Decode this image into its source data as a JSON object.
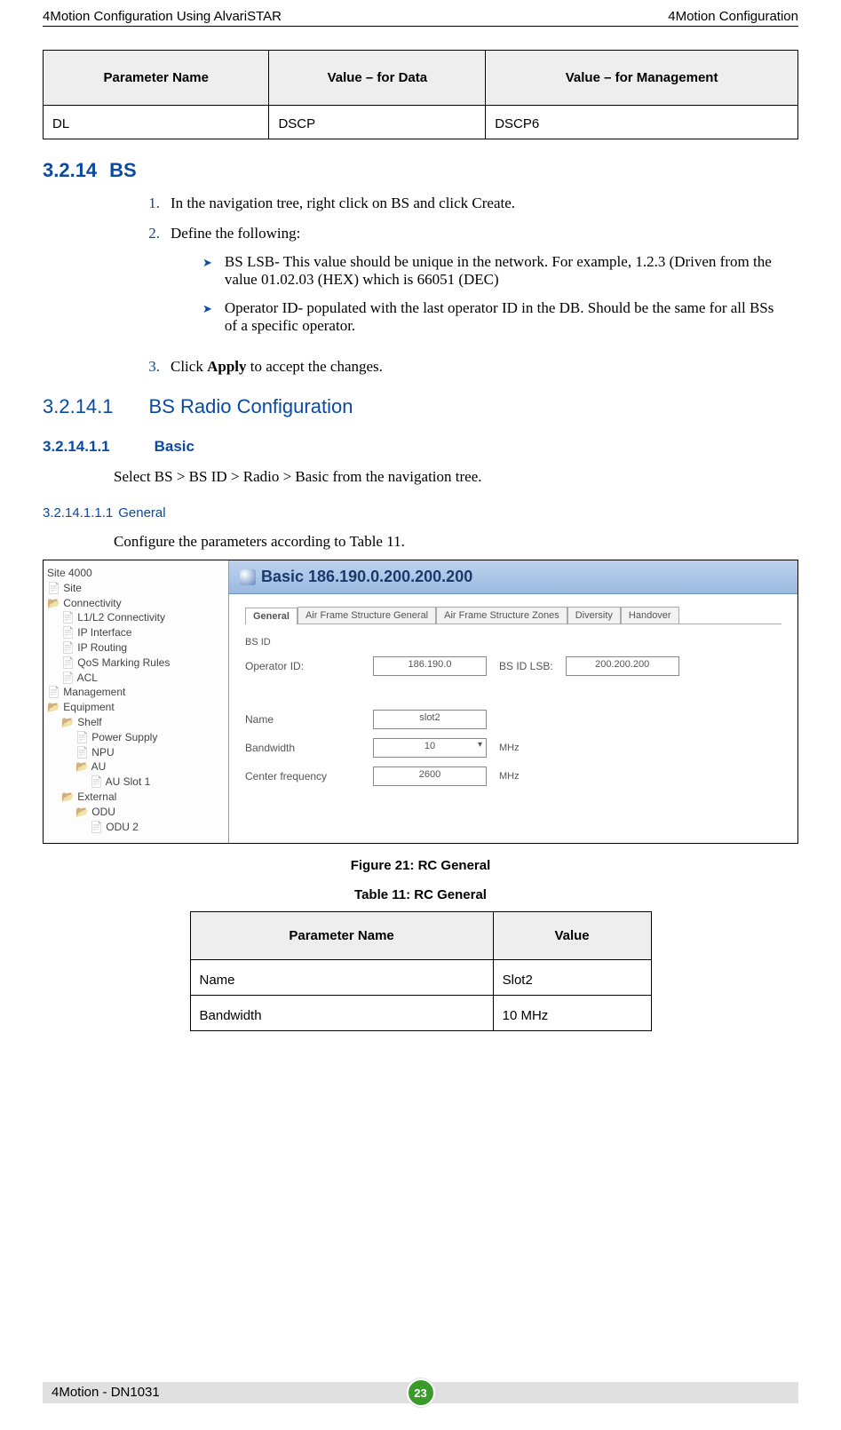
{
  "header": {
    "left": "4Motion Configuration Using AlvariSTAR",
    "right": "4Motion Configuration"
  },
  "topTable": {
    "headers": [
      "Parameter Name",
      "Value – for Data",
      "Value – for Management"
    ],
    "row": [
      "DL",
      "DSCP",
      "DSCP6"
    ]
  },
  "sections": {
    "s3214": {
      "num": "3.2.14",
      "title": "BS"
    },
    "s32141": {
      "num": "3.2.14.1",
      "title": "BS Radio Configuration"
    },
    "s321411": {
      "num": "3.2.14.1.1",
      "title": "Basic"
    },
    "s3214111": {
      "num": "3.2.14.1.1.1",
      "title": "General"
    }
  },
  "steps": {
    "s1": {
      "n": "1.",
      "text": "In the navigation tree, right click on BS and click Create."
    },
    "s2": {
      "n": "2.",
      "text": "Define the following:"
    },
    "b1": "BS LSB- This value should be unique in the network. For example, 1.2.3 (Driven from the value 01.02.03 (HEX) which is 66051 (DEC)",
    "b2": "Operator ID- populated with the last operator ID in the DB. Should be the same for all BSs of a specific operator.",
    "s3": {
      "n": "3.",
      "pre": "Click ",
      "bold": "Apply",
      "post": " to accept the changes."
    }
  },
  "basicIntro": "Select BS > BS ID > Radio > Basic from the navigation tree.",
  "generalIntro": "Configure the parameters according to Table 11.",
  "mock": {
    "rootLabel": "Site 4000",
    "tree": {
      "site": "Site",
      "connectivity": "Connectivity",
      "l1l2": "L1/L2 Connectivity",
      "ipif": "IP Interface",
      "iprt": "IP Routing",
      "qos": "QoS Marking Rules",
      "acl": "ACL",
      "mgmt": "Management",
      "equip": "Equipment",
      "shelf": "Shelf",
      "psu": "Power Supply",
      "npu": "NPU",
      "au": "AU",
      "auslot": "AU Slot 1",
      "ext": "External",
      "odu": "ODU",
      "odu2": "ODU 2"
    },
    "titlebar": "Basic 186.190.0.200.200.200",
    "tabs": [
      "General",
      "Air Frame Structure General",
      "Air Frame Structure Zones",
      "Diversity",
      "Handover"
    ],
    "fieldsetLabel": "BS ID",
    "fields": {
      "operatorIdLabel": "Operator ID:",
      "operatorIdValue": "186.190.0",
      "bsIdLsbLabel": "BS ID LSB:",
      "bsIdLsbValue": "200.200.200",
      "nameLabel": "Name",
      "nameValue": "slot2",
      "bandwidthLabel": "Bandwidth",
      "bandwidthValue": "10",
      "bandwidthUnit": "MHz",
      "centerFreqLabel": "Center frequency",
      "centerFreqValue": "2600",
      "centerFreqUnit": "MHz"
    }
  },
  "figureCaption": "Figure 21: RC General",
  "tableCaption": "Table 11: RC General",
  "table11": {
    "headers": [
      "Parameter Name",
      "Value"
    ],
    "rows": [
      [
        "Name",
        "Slot2"
      ],
      [
        "Bandwidth",
        "10 MHz"
      ]
    ]
  },
  "footer": {
    "left": "4Motion - DN1031",
    "page": "23"
  }
}
